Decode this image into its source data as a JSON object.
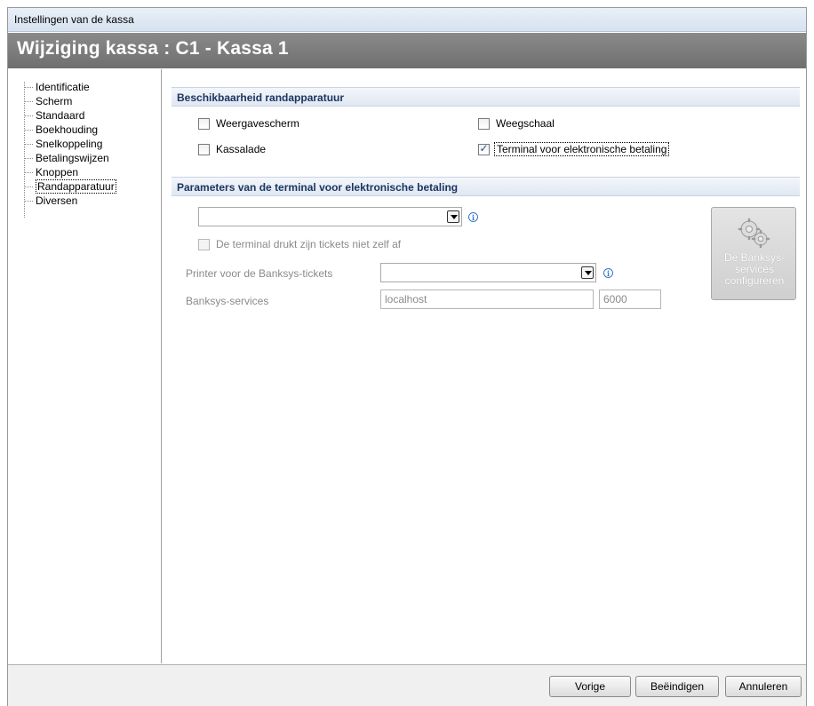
{
  "window": {
    "title": "Instellingen van de kassa"
  },
  "header": {
    "title": "Wijziging kassa : C1 - Kassa 1"
  },
  "sidebar": {
    "items": [
      {
        "label": "Identificatie"
      },
      {
        "label": "Scherm"
      },
      {
        "label": "Standaard"
      },
      {
        "label": "Boekhouding"
      },
      {
        "label": "Snelkoppeling"
      },
      {
        "label": "Betalingswijzen"
      },
      {
        "label": "Knoppen"
      },
      {
        "label": "Randapparatuur"
      },
      {
        "label": "Diversen"
      }
    ],
    "selected": "Randapparatuur"
  },
  "availability": {
    "heading": "Beschikbaarheid randapparatuur",
    "display_screen": {
      "label": "Weergavescherm",
      "checked": false
    },
    "scale": {
      "label": "Weegschaal",
      "checked": false
    },
    "cash_drawer": {
      "label": "Kassalade",
      "checked": false
    },
    "payment_terminal": {
      "label": "Terminal voor elektronische betaling",
      "checked": true
    }
  },
  "terminal_params": {
    "heading": "Parameters van de terminal voor elektronische betaling",
    "terminal_type": {
      "value": ""
    },
    "no_print_tickets": {
      "label": "De terminal drukt zijn tickets niet zelf af",
      "checked": false
    },
    "printer": {
      "label": "Printer voor de Banksys-tickets",
      "value": ""
    },
    "services": {
      "label": "Banksys-services",
      "host": "localhost",
      "port": "6000"
    },
    "configure_button": {
      "label": "De Banksys-services configureren"
    }
  },
  "footer": {
    "previous": "Vorige",
    "finish": "Beëindigen",
    "cancel": "Annuleren"
  },
  "icons": {
    "info": "info-icon",
    "gears": "gears-icon",
    "dropdown": "chevron-down-icon",
    "checkmark": "check-icon"
  }
}
